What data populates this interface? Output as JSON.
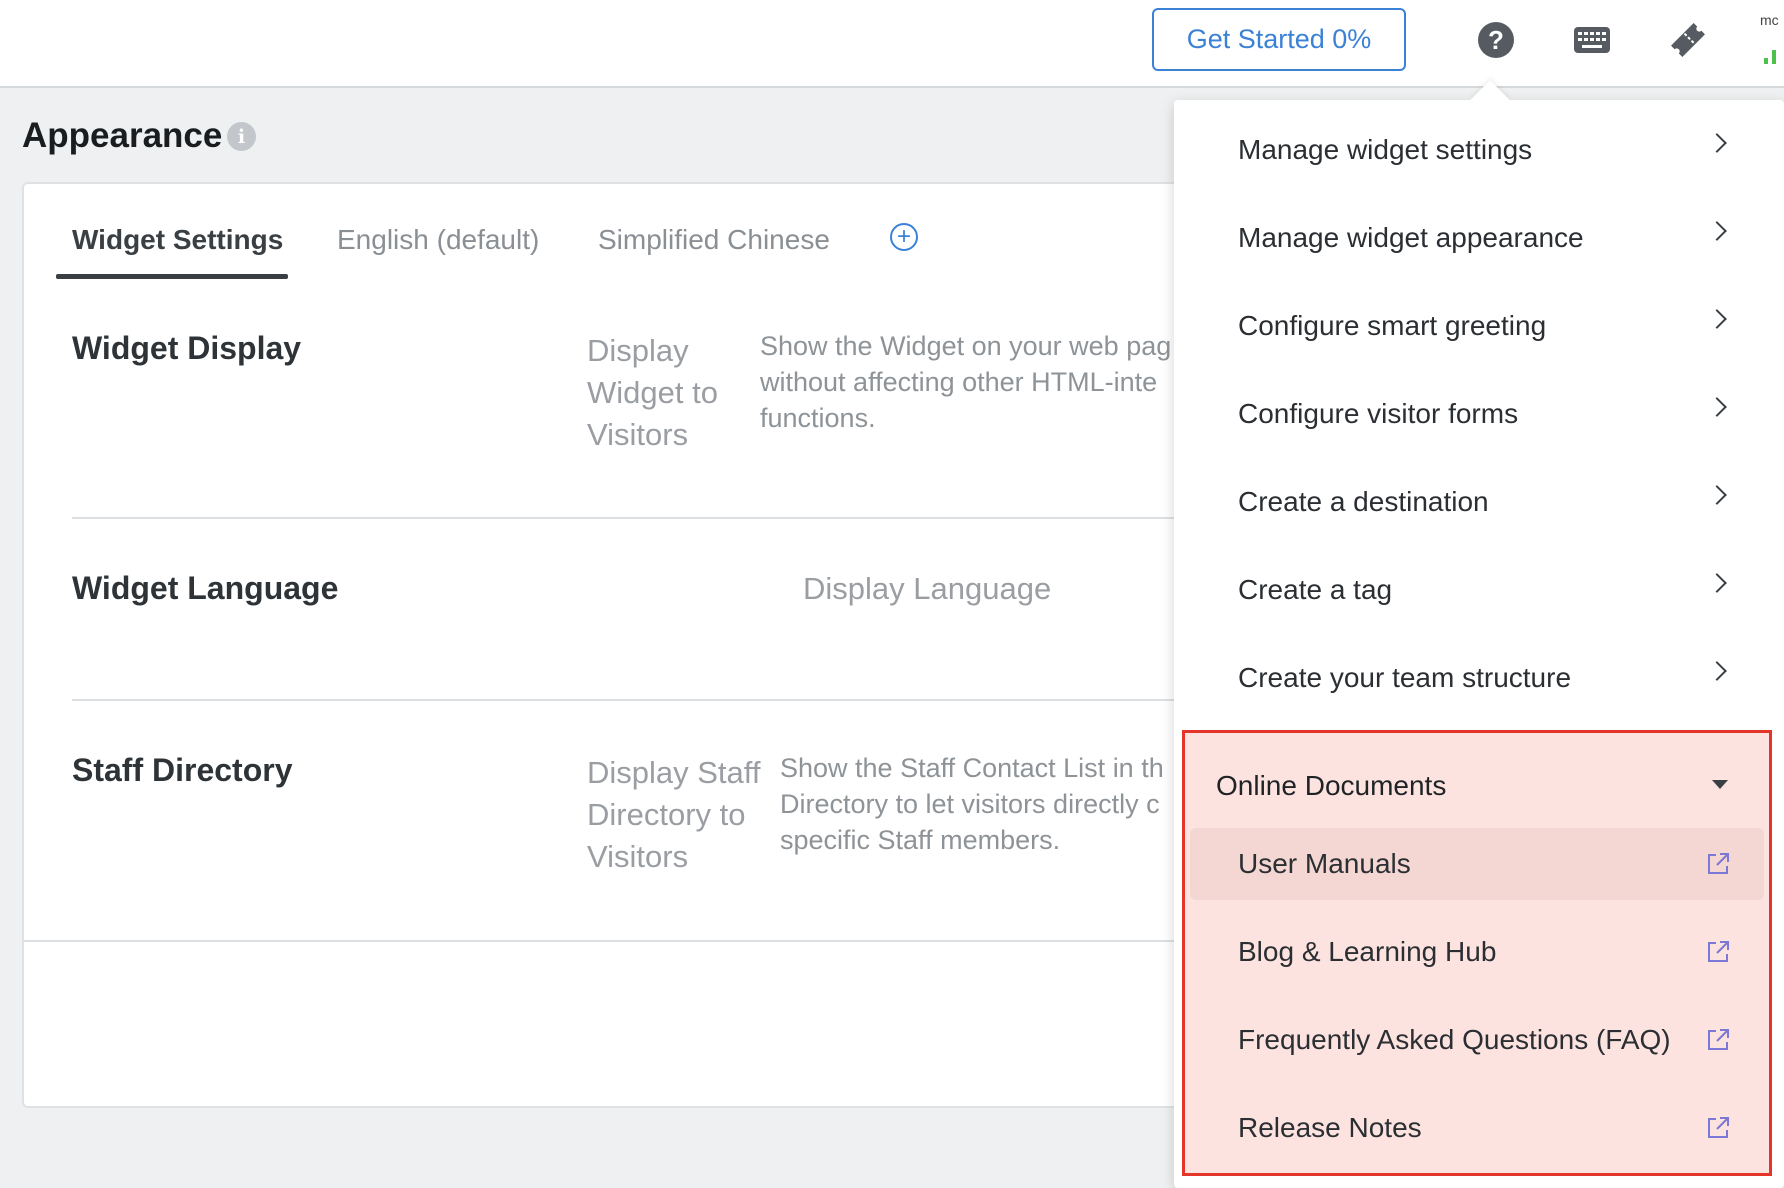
{
  "topbar": {
    "get_started_label": "Get Started 0%",
    "user_initials": "mc",
    "icons": [
      "help-icon",
      "keyboard-icon",
      "ticket-icon",
      "signal-icon"
    ]
  },
  "page": {
    "title": "Appearance"
  },
  "tabs": [
    {
      "label": "Widget Settings",
      "active": true
    },
    {
      "label": "English (default)",
      "active": false
    },
    {
      "label": "Simplified Chinese",
      "active": false
    }
  ],
  "sections": {
    "widget_display": {
      "title": "Widget Display",
      "label_lines": [
        "Display",
        "Widget to",
        "Visitors"
      ],
      "desc_lines": [
        "Show the Widget on your web pag",
        "without affecting other HTML-inte",
        "functions."
      ]
    },
    "widget_language": {
      "title": "Widget Language",
      "label": "Display Language"
    },
    "staff_directory": {
      "title": "Staff Directory",
      "label_lines": [
        "Display Staff",
        "Directory to",
        "Visitors"
      ],
      "desc_lines": [
        "Show the Staff Contact List in th",
        "Directory to let visitors directly c",
        "specific Staff members."
      ]
    }
  },
  "help_menu": {
    "items": [
      "Manage widget settings",
      "Manage widget appearance",
      "Configure smart greeting",
      "Configure visitor forms",
      "Create a destination",
      "Create a tag",
      "Create your team structure"
    ],
    "group": {
      "title": "Online Documents",
      "items": [
        "User Manuals",
        "Blog & Learning Hub",
        "Frequently Asked Questions (FAQ)",
        "Release Notes"
      ]
    }
  },
  "colors": {
    "accent": "#3b82d6",
    "highlight_border": "#e4352a",
    "highlight_fill": "#fde3df",
    "signal_green": "#4cc04a"
  }
}
